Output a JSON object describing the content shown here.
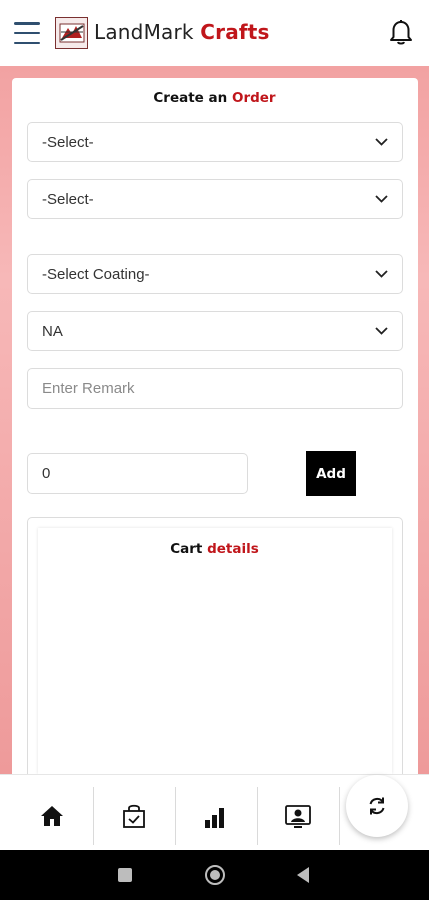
{
  "header": {
    "brand_main": "LandMark",
    "brand_accent": "Crafts"
  },
  "form": {
    "title_main": "Create an",
    "title_accent": "Order",
    "select1": "-Select-",
    "select2": "-Select-",
    "coating": "-Select Coating-",
    "option4": "NA",
    "remark_placeholder": "Enter Remark",
    "quantity": "0",
    "add_label": "Add"
  },
  "cart": {
    "title_main": "Cart",
    "title_accent": "details"
  },
  "nav": {
    "items": [
      "home-icon",
      "shopping-bag-check-icon",
      "bar-chart-icon",
      "contact-card-icon"
    ],
    "fab": "refresh-icon"
  },
  "colors": {
    "accent": "#c0161b",
    "background_pink": "#f2a2a2",
    "button_black": "#000000"
  }
}
